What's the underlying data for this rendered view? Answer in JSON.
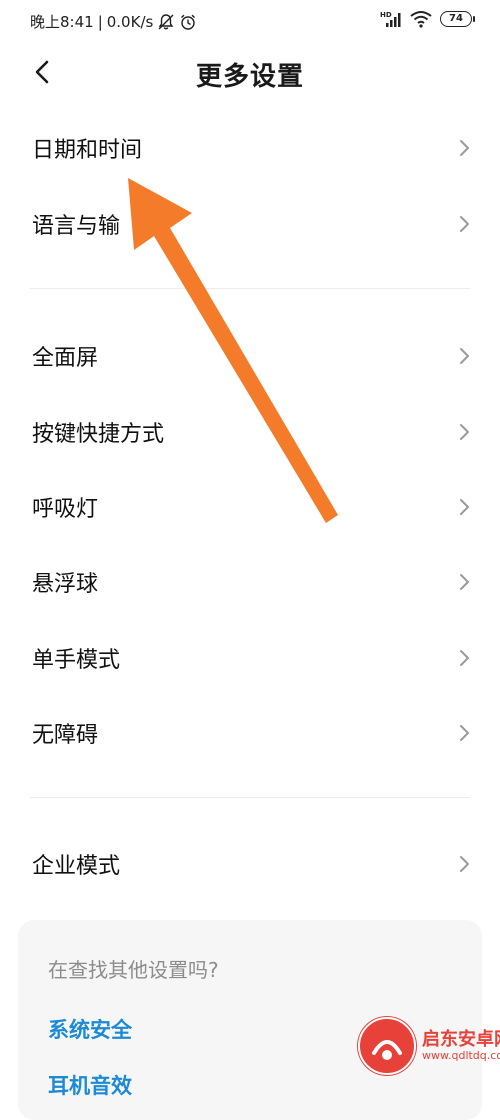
{
  "status_bar": {
    "time": "晚上8:41",
    "speed": "0.0K/s",
    "battery": "74",
    "hd_label": "HD"
  },
  "header": {
    "title": "更多设置",
    "back_icon": "chevron-left-icon"
  },
  "settings_groups": [
    {
      "items": [
        {
          "label": "日期和时间"
        },
        {
          "label": "语言与输"
        }
      ]
    },
    {
      "items": [
        {
          "label": "全面屏"
        },
        {
          "label": "按键快捷方式"
        },
        {
          "label": "呼吸灯"
        },
        {
          "label": "悬浮球"
        },
        {
          "label": "单手模式"
        },
        {
          "label": "无障碍"
        }
      ]
    },
    {
      "items": [
        {
          "label": "企业模式"
        }
      ]
    }
  ],
  "suggestions": {
    "title": "在查找其他设置吗?",
    "links": [
      "系统安全",
      "耳机音效"
    ]
  },
  "annotation": {
    "color": "#f47b2a"
  },
  "watermark": {
    "name": "启东安卓网",
    "url": "www.qdltdq.com"
  },
  "colors": {
    "link": "#1c8ad6",
    "muted": "#8c8c8c",
    "arrow": "#f47b2a",
    "watermark": "#e8413a"
  }
}
